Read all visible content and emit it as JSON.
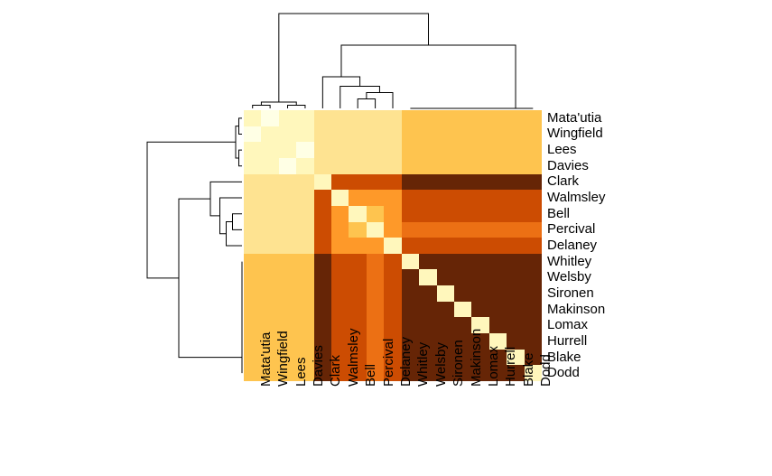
{
  "chart_data": {
    "type": "heatmap",
    "title": "",
    "xlabel": "",
    "ylabel": "",
    "legend": "none",
    "categories": [
      "Mata'utia",
      "Wingfield",
      "Lees",
      "Davies",
      "Clark",
      "Walmsley",
      "Bell",
      "Percival",
      "Delaney",
      "Whitley",
      "Welsby",
      "Sironen",
      "Makinson",
      "Lomax",
      "Hurrell",
      "Blake",
      "Dodd"
    ],
    "palette": {
      "0": "#FFFFE5",
      "1": "#FFF7BC",
      "2": "#FEE391",
      "3": "#FEC44F",
      "4": "#FE9929",
      "5": "#EC7014",
      "6": "#CC4C02",
      "7": "#993404",
      "8": "#662506"
    },
    "matrix": [
      [
        1,
        0,
        1,
        1,
        2,
        2,
        2,
        2,
        2,
        3,
        3,
        3,
        3,
        3,
        3,
        3,
        3
      ],
      [
        0,
        1,
        1,
        1,
        2,
        2,
        2,
        2,
        2,
        3,
        3,
        3,
        3,
        3,
        3,
        3,
        3
      ],
      [
        1,
        1,
        1,
        0,
        2,
        2,
        2,
        2,
        2,
        3,
        3,
        3,
        3,
        3,
        3,
        3,
        3
      ],
      [
        1,
        1,
        0,
        1,
        2,
        2,
        2,
        2,
        2,
        3,
        3,
        3,
        3,
        3,
        3,
        3,
        3
      ],
      [
        2,
        2,
        2,
        2,
        1,
        6,
        6,
        6,
        6,
        8,
        8,
        8,
        8,
        8,
        8,
        8,
        8
      ],
      [
        2,
        2,
        2,
        2,
        6,
        1,
        4,
        4,
        4,
        6,
        6,
        6,
        6,
        6,
        6,
        6,
        6
      ],
      [
        2,
        2,
        2,
        2,
        6,
        4,
        1,
        3,
        4,
        6,
        6,
        6,
        6,
        6,
        6,
        6,
        6
      ],
      [
        2,
        2,
        2,
        2,
        6,
        4,
        3,
        1,
        4,
        5,
        5,
        5,
        5,
        5,
        5,
        5,
        5
      ],
      [
        2,
        2,
        2,
        2,
        6,
        4,
        4,
        4,
        1,
        6,
        6,
        6,
        6,
        6,
        6,
        6,
        6
      ],
      [
        3,
        3,
        3,
        3,
        8,
        6,
        6,
        5,
        6,
        1,
        8,
        8,
        8,
        8,
        8,
        8,
        8
      ],
      [
        3,
        3,
        3,
        3,
        8,
        6,
        6,
        5,
        6,
        8,
        1,
        8,
        8,
        8,
        8,
        8,
        8
      ],
      [
        3,
        3,
        3,
        3,
        8,
        6,
        6,
        5,
        6,
        8,
        8,
        1,
        8,
        8,
        8,
        8,
        8
      ],
      [
        3,
        3,
        3,
        3,
        8,
        6,
        6,
        5,
        6,
        8,
        8,
        8,
        1,
        8,
        8,
        8,
        8
      ],
      [
        3,
        3,
        3,
        3,
        8,
        6,
        6,
        5,
        6,
        8,
        8,
        8,
        8,
        1,
        8,
        8,
        8
      ],
      [
        3,
        3,
        3,
        3,
        8,
        6,
        6,
        5,
        6,
        8,
        8,
        8,
        8,
        8,
        1,
        8,
        8
      ],
      [
        3,
        3,
        3,
        3,
        8,
        6,
        6,
        5,
        6,
        8,
        8,
        8,
        8,
        8,
        8,
        1,
        8
      ],
      [
        3,
        3,
        3,
        3,
        8,
        6,
        6,
        5,
        6,
        8,
        8,
        8,
        8,
        8,
        8,
        8,
        1
      ]
    ],
    "row_clusters": {
      "description": "hierarchical clustering merges (row indices, 0-based, negative=leaf)",
      "merges": [
        [
          -1,
          -2,
          2
        ],
        [
          -3,
          -4,
          2
        ],
        [
          17,
          18,
          4
        ],
        [
          -7,
          -8,
          6
        ],
        [
          -9,
          20,
          10
        ],
        [
          -6,
          21,
          14
        ],
        [
          -5,
          22,
          20
        ],
        [
          -10,
          -11,
          0
        ],
        [
          -12,
          24,
          0
        ],
        [
          -13,
          25,
          0
        ],
        [
          -14,
          26,
          0
        ],
        [
          -15,
          27,
          0
        ],
        [
          -16,
          28,
          0
        ],
        [
          -17,
          29,
          0
        ],
        [
          23,
          30,
          40
        ],
        [
          19,
          31,
          60
        ]
      ]
    },
    "col_clusters": "same as row_clusters"
  }
}
